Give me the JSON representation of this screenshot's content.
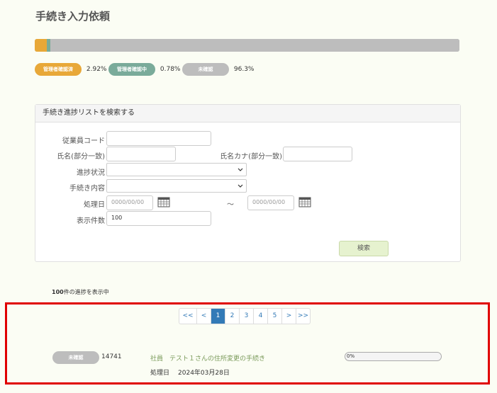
{
  "page": {
    "title": "手続き入力依頼"
  },
  "progress": {
    "segments": [
      {
        "name": "管理者確認済",
        "fraction": 0.0292,
        "color": "#e8a838"
      },
      {
        "name": "管理者確認中",
        "fraction": 0.0078,
        "color": "#7aab9a"
      },
      {
        "name": "未確認",
        "fraction": 0.963,
        "color": "#bdbdbd"
      }
    ],
    "legend": [
      {
        "label": "管理者確認済",
        "pct": "2.92%",
        "color": "#e8a838"
      },
      {
        "label": "管理者確認中",
        "pct": "0.78%",
        "color": "#7aab9a"
      },
      {
        "label": "未確認",
        "pct": "96.3%",
        "color": "#bdbdbd"
      }
    ]
  },
  "search": {
    "heading": "手続き進捗リストを検索する",
    "employee_code_label": "従業員コード",
    "employee_code_value": "",
    "name_label": "氏名(部分一致)",
    "name_value": "",
    "kana_label": "氏名カナ(部分一致)",
    "kana_value": "",
    "status_label": "進捗状況",
    "status_value": "",
    "procedure_label": "手続き内容",
    "procedure_value": "",
    "date_label": "処理日",
    "date_from_placeholder": "0000/00/00",
    "date_to_placeholder": "0000/00/00",
    "tilde": "〜",
    "count_label": "表示件数",
    "count_value": "100",
    "search_button": "検索"
  },
  "results": {
    "count": "100",
    "count_suffix": "件の進捗を表示中"
  },
  "pagination": [
    "<<",
    "<",
    "1",
    "2",
    "3",
    "4",
    "5",
    ">",
    ">>"
  ],
  "pagination_active": "1",
  "item": {
    "status": "未確認",
    "id": "14741",
    "title": "社員　テスト１さんの住所変更の手続き",
    "progress_label": "0%",
    "progress_value": 0,
    "date_label": "処理日",
    "date_value": "2024年03月28日"
  }
}
